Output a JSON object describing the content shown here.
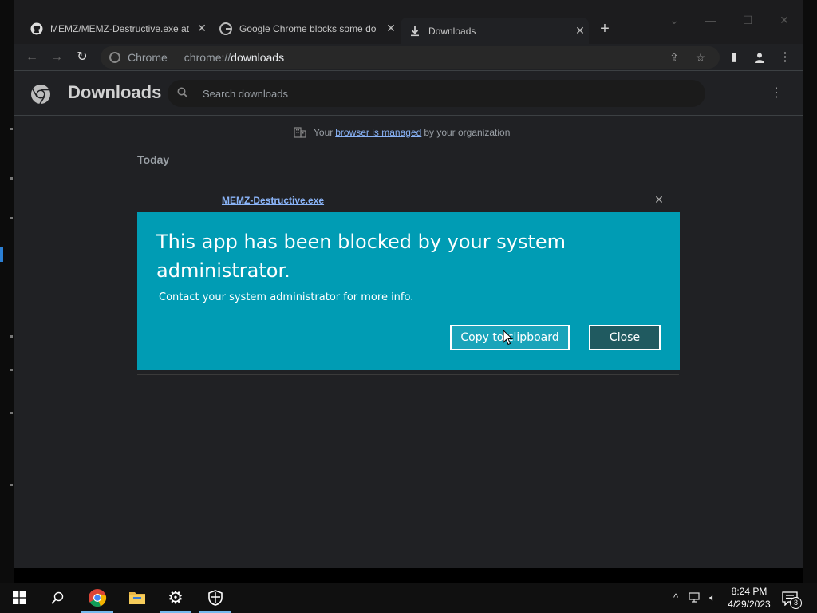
{
  "tabs": [
    {
      "title": "MEMZ/MEMZ-Destructive.exe at",
      "icon": "github-icon"
    },
    {
      "title": "Google Chrome blocks some do",
      "icon": "google-icon"
    },
    {
      "title": "Downloads",
      "icon": "download-icon"
    }
  ],
  "omnibox": {
    "chip": "Chrome",
    "url_scheme": "chrome://",
    "url_path": "downloads"
  },
  "downloads_page": {
    "title": "Downloads",
    "search_placeholder": "Search downloads",
    "managed_prefix": "Your",
    "managed_link": "browser is managed",
    "managed_suffix": "by your organization",
    "date_header": "Today",
    "file_name": "MEMZ-Destructive.exe"
  },
  "dialog": {
    "title": "This app has been blocked by your system administrator.",
    "message": "Contact your system administrator for more info.",
    "copy_label": "Copy to clipboard",
    "close_label": "Close",
    "bg_color": "#009cb4"
  },
  "taskbar": {
    "time": "8:24 PM",
    "date": "4/29/2023",
    "notification_count": "3"
  }
}
